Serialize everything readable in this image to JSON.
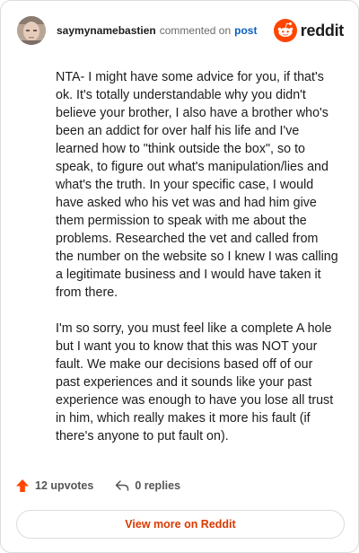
{
  "header": {
    "username": "saymynamebastien",
    "commented_text": "commented on",
    "post_link": "post",
    "brand": "reddit"
  },
  "comment": {
    "paragraphs": [
      "NTA- I might have some advice for you, if that's ok. It's totally understandable why you didn't believe your brother, I also have a brother who's been an addict for over half his life and I've learned how to \"think outside the box\", so to speak, to figure out what's manipulation/lies and what's the truth. In your specific case, I would have asked who his vet was and had him give them permission to speak with me about the problems. Researched the vet and called from the number on the website so I knew I was calling a legitimate business and I would have taken it from there.",
      "I'm so sorry, you must feel like a complete A hole but I want you to know that this was NOT your fault. We make our decisions based off of our past experiences and it sounds like your past experience was enough to have you lose all trust in him, which really makes it more his fault (if there's anyone to put fault on)."
    ]
  },
  "actions": {
    "upvotes": "12 upvotes",
    "replies": "0 replies"
  },
  "footer": {
    "view_more": "View more on Reddit"
  },
  "colors": {
    "accent": "#ff4500",
    "link": "#0a5ec4",
    "view_more": "#d93900"
  },
  "icons": {
    "upvote": "upvote-arrow-icon",
    "reply": "reply-arrow-icon",
    "brand": "reddit-snoo-icon"
  }
}
